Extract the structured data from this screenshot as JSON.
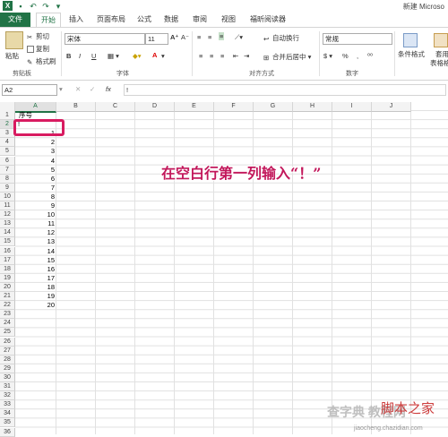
{
  "title_bar": {
    "app_title": "新建 Microso"
  },
  "tabs": [
    {
      "label": "文件"
    },
    {
      "label": "开始"
    },
    {
      "label": "插入"
    },
    {
      "label": "页面布局"
    },
    {
      "label": "公式"
    },
    {
      "label": "数据"
    },
    {
      "label": "审阅"
    },
    {
      "label": "视图"
    },
    {
      "label": "福昕阅读器"
    }
  ],
  "ribbon": {
    "clipboard": {
      "paste": "粘贴",
      "cut": "剪切",
      "copy": "复制",
      "format_painter": "格式刷",
      "group": "剪贴板"
    },
    "font": {
      "font_name": "宋体",
      "font_size": "11",
      "bold": "B",
      "italic": "I",
      "underline": "U",
      "group": "字体",
      "font_color_glyph": "A"
    },
    "alignment": {
      "wrap_text": "自动换行",
      "merge_center": "合并后居中",
      "group": "对齐方式"
    },
    "number": {
      "format": "常规",
      "percent": "%",
      "comma": ",",
      "group": "数字",
      "currency": "$"
    },
    "styles": {
      "conditional": "条件格式",
      "table_format": "套用",
      "table_format2": "表格格"
    }
  },
  "formula_bar": {
    "name_box": "A2",
    "fx": "fx",
    "value": "!"
  },
  "columns": [
    "A",
    "B",
    "C",
    "D",
    "E",
    "F",
    "G",
    "H",
    "I",
    "J"
  ],
  "rows": [
    "1",
    "2",
    "3",
    "4",
    "5",
    "6",
    "7",
    "8",
    "9",
    "10",
    "11",
    "12",
    "13",
    "14",
    "15",
    "16",
    "17",
    "18",
    "19",
    "20",
    "21",
    "22",
    "23",
    "24",
    "25",
    "26",
    "27",
    "28",
    "29",
    "30",
    "31",
    "32",
    "33",
    "34",
    "35",
    "36"
  ],
  "cells": {
    "A1": "序号",
    "A2": "!",
    "A3": "1",
    "A4": "2",
    "A5": "3",
    "A6": "4",
    "A7": "5",
    "A8": "6",
    "A9": "7",
    "A10": "8",
    "A11": "9",
    "A12": "10",
    "A13": "11",
    "A14": "12",
    "A15": "13",
    "A16": "14",
    "A17": "15",
    "A18": "16",
    "A19": "17",
    "A20": "18",
    "A21": "19",
    "A22": "20"
  },
  "annotation": "在空白行第一列输入“！”",
  "watermark": {
    "site": "脚本之家",
    "domain": "jiaocheng.chazidian.com",
    "brand": "查字典 教程网"
  },
  "colors": {
    "excel_green": "#217346",
    "annotation": "#c2185b",
    "highlight_border": "#d81b60"
  }
}
